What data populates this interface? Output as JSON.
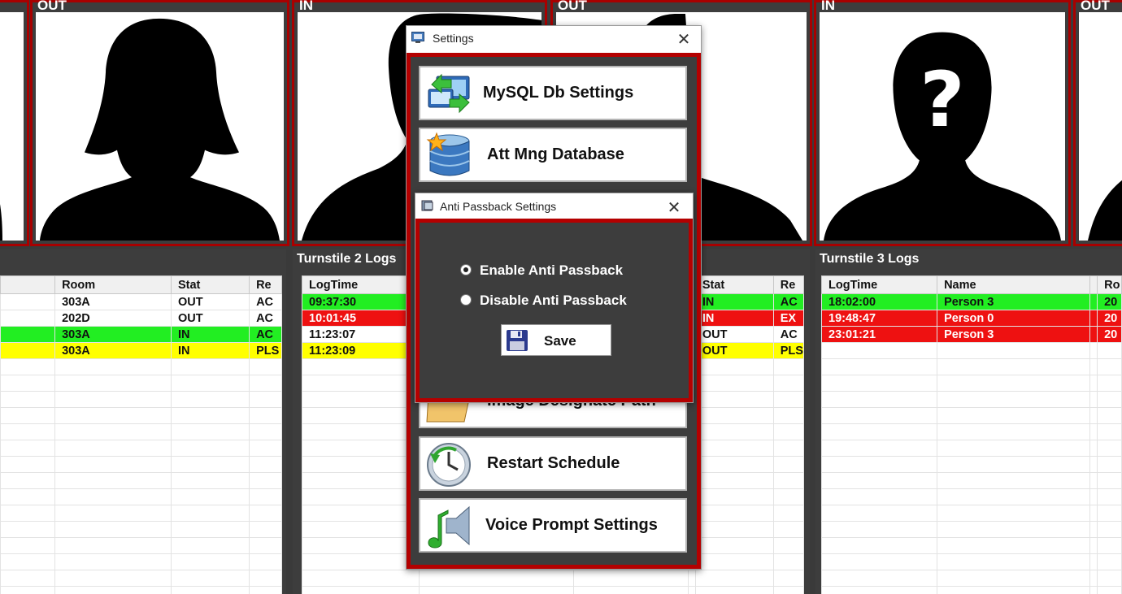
{
  "photos": [
    {
      "label": "OUT",
      "silhouette": "female-icon"
    },
    {
      "label": "IN",
      "silhouette": "male-icon"
    },
    {
      "label": "OUT",
      "silhouette": "male-icon"
    },
    {
      "label": "IN",
      "silhouette": "unknown-person-icon"
    },
    {
      "label": "OUT",
      "silhouette": "male-icon"
    }
  ],
  "log1": {
    "title": "Turnstile 1 Logs",
    "columns": [
      "Room",
      "Stat",
      "Re"
    ],
    "rows": [
      {
        "cells": [
          "303A",
          "OUT",
          "AC"
        ],
        "style": ""
      },
      {
        "cells": [
          "202D",
          "OUT",
          "AC"
        ],
        "style": ""
      },
      {
        "cells": [
          "303A",
          "IN",
          "AC"
        ],
        "style": "green"
      },
      {
        "cells": [
          "303A",
          "IN",
          "PLS"
        ],
        "style": "yellow"
      }
    ]
  },
  "log2": {
    "title": "Turnstile 2 Logs",
    "columns": [
      "LogTime",
      "",
      "",
      "",
      "Stat",
      "Re"
    ],
    "rows": [
      {
        "cells": [
          "09:37:30",
          "",
          "",
          "",
          "IN",
          "AC"
        ],
        "style": "green"
      },
      {
        "cells": [
          "10:01:45",
          "",
          "",
          "",
          "IN",
          "EX"
        ],
        "style": "red"
      },
      {
        "cells": [
          "11:23:07",
          "",
          "",
          "",
          "OUT",
          "AC"
        ],
        "style": ""
      },
      {
        "cells": [
          "11:23:09",
          "",
          "",
          "",
          "OUT",
          "PLS"
        ],
        "style": "yellow"
      }
    ]
  },
  "log3": {
    "title": "Turnstile 3 Logs",
    "columns": [
      "LogTime",
      "Name",
      "",
      "Ro"
    ],
    "rows": [
      {
        "cells": [
          "18:02:00",
          "Person 3",
          "",
          "20"
        ],
        "style": "green"
      },
      {
        "cells": [
          "19:48:47",
          "Person 0",
          "",
          "20"
        ],
        "style": "red"
      },
      {
        "cells": [
          "23:01:21",
          "Person 3",
          "",
          "20"
        ],
        "style": "red"
      }
    ]
  },
  "settings": {
    "title": "Settings",
    "close": "✕",
    "buttons": [
      {
        "label": "MySQL Db Settings",
        "icon": "database-sync-icon"
      },
      {
        "label": "Att Mng Database",
        "icon": "database-icon"
      },
      {
        "label": "Image Designate Path",
        "icon": "folder-image-icon"
      },
      {
        "label": "Restart Schedule",
        "icon": "clock-refresh-icon"
      },
      {
        "label": "Voice Prompt Settings",
        "icon": "speaker-music-icon"
      }
    ]
  },
  "antipassback": {
    "title": "Anti Passback Settings",
    "close": "✕",
    "enable_label": "Enable Anti Passback",
    "disable_label": "Disable Anti Passback",
    "selected": "enable",
    "save_label": "Save"
  },
  "colors": {
    "accent_red": "#b40000",
    "row_green": "#22ee22",
    "row_red": "#ee1111",
    "row_yellow": "#ffff00",
    "panel_bg": "#3d3d3d"
  }
}
